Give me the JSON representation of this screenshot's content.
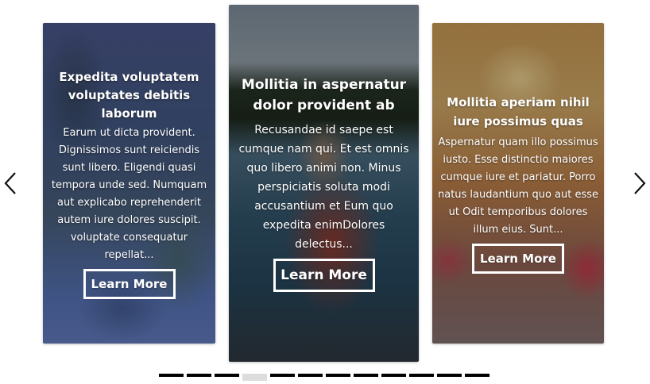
{
  "carousel": {
    "prev_icon": "chevron-left-icon",
    "next_icon": "chevron-right-icon",
    "cards": [
      {
        "title": "Expedita voluptatem voluptates debitis laborum",
        "text": "Earum ut dicta provident. Dignissimos sunt reiciendis sunt libero. Eligendi quasi tempora unde sed. Numquam aut explicabo reprehenderit autem iure dolores suscipit. voluptate consequatur repellat...",
        "button": "Learn More"
      },
      {
        "title": "Mollitia in aspernatur dolor provident ab",
        "text": "Recusandae id saepe est cumque nam qui. Et est omnis quo libero animi non. Minus perspiciatis soluta modi accusantium et Eum quo expedita enimDolores delectus...",
        "button": "Learn More"
      },
      {
        "title": "Mollitia aperiam nihil iure possimus quas",
        "text": "Aspernatur quam illo possimus iusto. Esse distinctio maiores cumque iure et pariatur. Porro natus laudantium quo aut esse ut Odit temporibus dolores illum eius. Sunt...",
        "button": "Learn More"
      }
    ],
    "pagination": {
      "total": 12,
      "active_index": 3
    }
  }
}
